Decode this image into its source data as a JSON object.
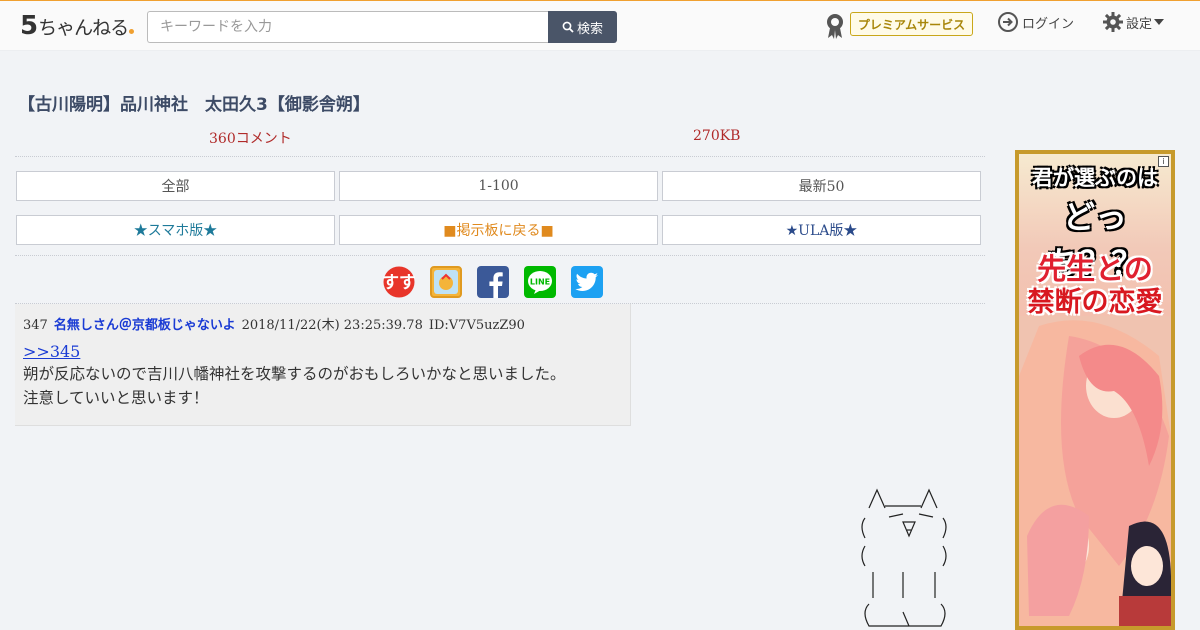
{
  "header": {
    "logo_text": "ちゃんねる",
    "logo_digit": "5",
    "search_placeholder": "キーワードを入力",
    "search_button": "検索",
    "premium_button": "プレミアムサービス",
    "login": "ログイン",
    "settings": "設定"
  },
  "thread": {
    "title": "【古川陽明】品川神社　太田久3【御影舎朔】",
    "comments": "360コメント",
    "size": "270KB"
  },
  "nav": {
    "all": "全部",
    "range": "1-100",
    "latest": "最新50",
    "smartphone": "★スマホ版★",
    "back_to_board": "■掲示板に戻る■",
    "ula": "★ULA版★"
  },
  "share_icons": [
    "matome-icon",
    "blog-icon",
    "facebook-icon",
    "line-icon",
    "twitter-icon"
  ],
  "post": {
    "number": "347",
    "name": "名無しさん＠京都板じゃないよ",
    "date": "2018/11/22(木) 23:25:39.78",
    "id": "ID:V7V5uzZ90",
    "reply": ">>345",
    "body_line1": "朔が反応ないので吉川八幡神社を攻撃するのがおもしろいかなと思いました。",
    "body_line2": "注意していいと思います！"
  },
  "ad": {
    "line1": "君が選ぶのは",
    "line2": "どっち？？",
    "line3": "先生との",
    "line4": "禁断の恋愛",
    "badge": "i"
  },
  "colors": {
    "header_accent": "#f0a030",
    "link_blue": "#1a3bd4",
    "stat_red": "#b02a2a"
  }
}
